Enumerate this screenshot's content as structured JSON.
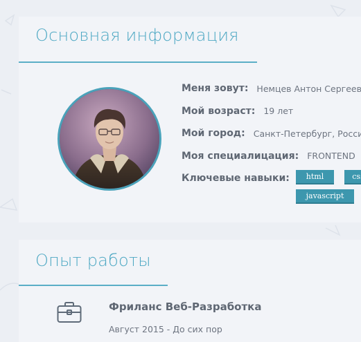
{
  "info_card": {
    "title": "Основная информация",
    "avatar_alt": "Фото профиля",
    "rows": [
      {
        "label": "Меня зовут:",
        "value": "Немцев Антон Сергеевич"
      },
      {
        "label": "Мой возраст:",
        "value": "19 лет"
      },
      {
        "label": "Мой город:",
        "value": "Санкт-Петербург, Россия"
      },
      {
        "label": "Моя специалицация:",
        "value": "FRONTEND"
      },
      {
        "label": "Ключевые навыки:",
        "value": ""
      }
    ],
    "skills": [
      "html",
      "css",
      "javascript"
    ]
  },
  "experience_card": {
    "title": "Опыт работы",
    "items": [
      {
        "icon": "briefcase-icon",
        "title": "Фриланс Веб-Разработка",
        "period": "Август 2015 - До сих пор"
      }
    ]
  },
  "colors": {
    "accent": "#4ea8c3",
    "tag": "#3d97ae",
    "text_label": "#5f6773",
    "text_value": "#6d7480",
    "card_bg": "#f2f4f8"
  }
}
